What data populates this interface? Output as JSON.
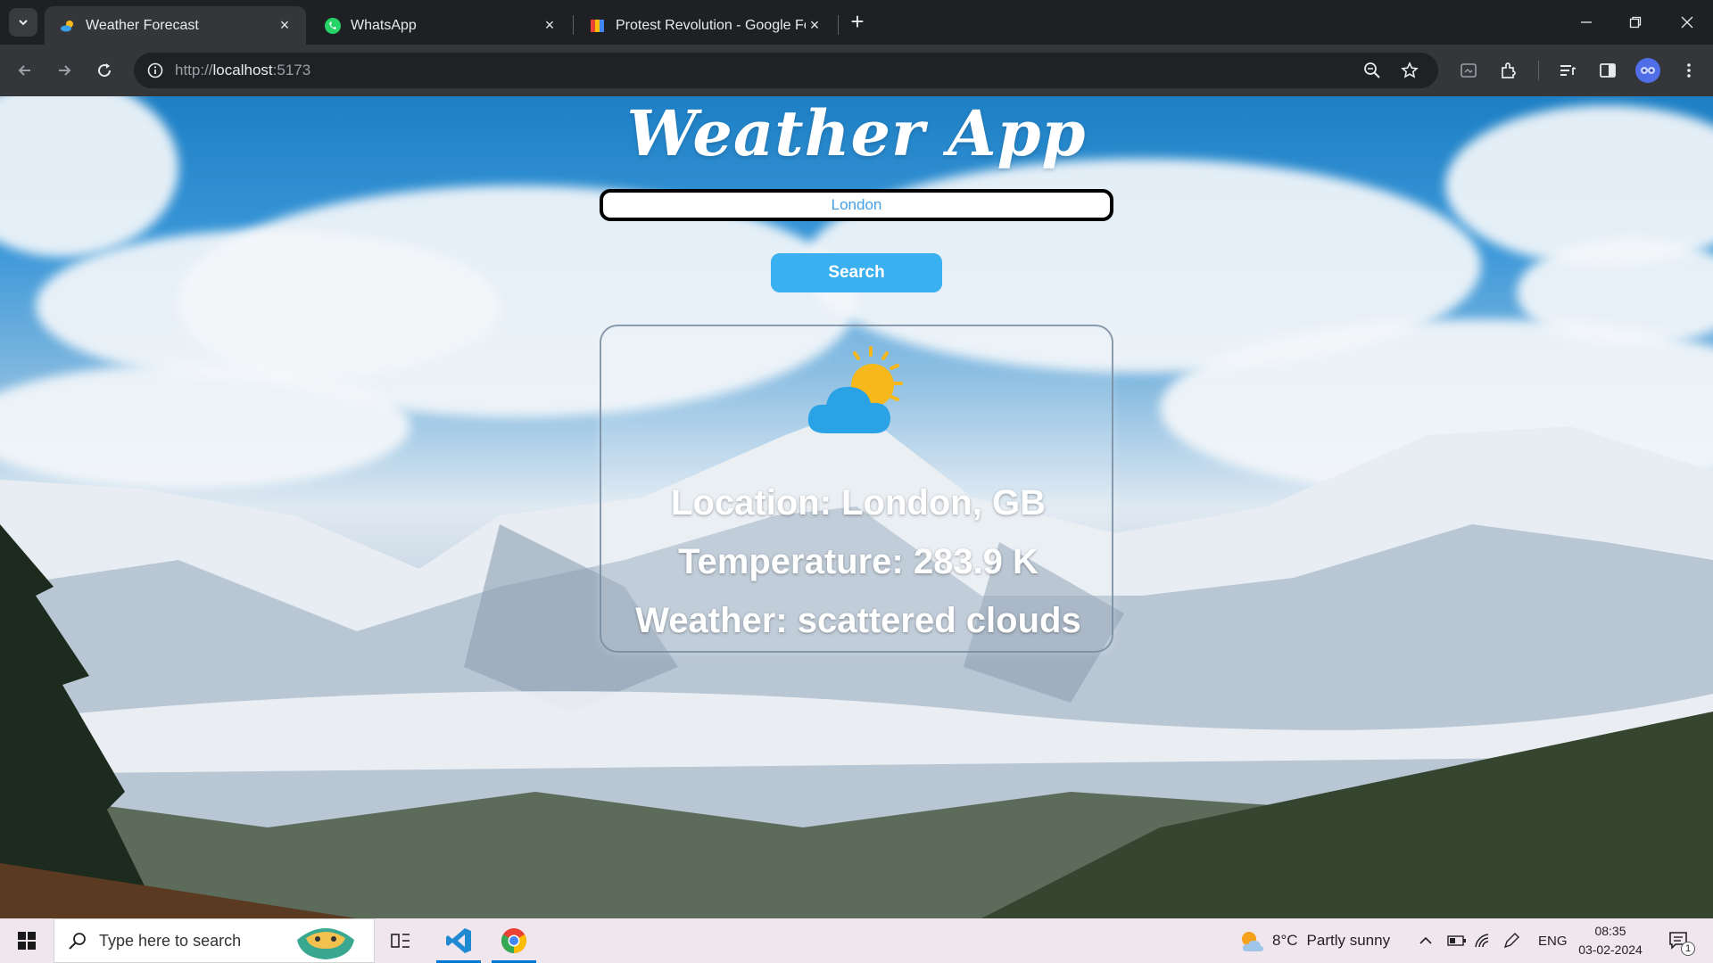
{
  "browser": {
    "tabs": [
      {
        "title": "Weather Forecast",
        "active": true
      },
      {
        "title": "WhatsApp",
        "active": false
      },
      {
        "title": "Protest Revolution - Google For",
        "active": false
      }
    ],
    "new_tab_label": "+",
    "url_prefix": "http://",
    "url_host": "localhost",
    "url_suffix": ":5173"
  },
  "app": {
    "title": "Weather App",
    "search": {
      "value": "London"
    },
    "search_button_label": "Search",
    "card": {
      "icon": "partly-cloudy-icon",
      "location": "Location: London, GB",
      "temperature": "Temperature: 283.9 K",
      "weather": "Weather: scattered clouds"
    }
  },
  "taskbar": {
    "search_placeholder": "Type here to search",
    "weather_temp": "8°C",
    "weather_desc": "Partly sunny",
    "language": "ENG",
    "time": "08:35",
    "date": "03-02-2024",
    "notification_count": "1"
  },
  "colors": {
    "accent_button": "#3bb0f0",
    "input_text": "#45a0e6",
    "tab_bg": "#1f2023",
    "toolbar_bg": "#35363a",
    "taskbar_bg": "#f0e6ee"
  }
}
